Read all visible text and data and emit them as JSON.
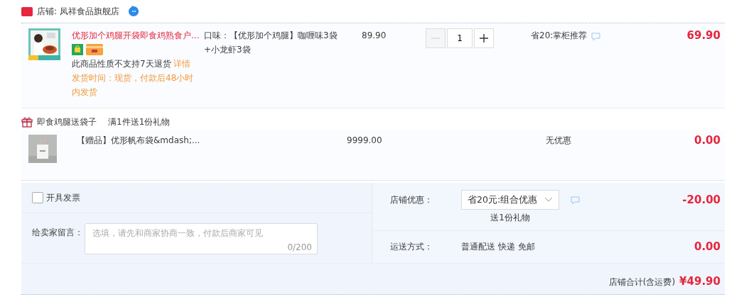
{
  "shop": {
    "label": "店铺: 凤祥食品旗舰店"
  },
  "items": [
    {
      "title": "优形加个鸡腿开袋即食鸡熟食户...",
      "spec": "口味：【优形加个鸡腿】咖喱味3袋+小龙虾3袋",
      "price": "89.90",
      "quantity": "1",
      "promo": "省20:掌柜推荐",
      "notice": "此商品性质不支持7天退货",
      "notice_link": "详情",
      "delivery": "发货时间：现货，付款后48小时内发货",
      "total": "69.90"
    }
  ],
  "gift_group": {
    "title": "即食鸡腿送袋子",
    "rule": "满1件送1份礼物"
  },
  "gifts": [
    {
      "title": "【赠品】优形帆布袋&mdash;...",
      "price": "9999.00",
      "promo": "无优惠",
      "total": "0.00"
    }
  ],
  "invoice": {
    "label": "开具发票",
    "checked": false
  },
  "message": {
    "label": "给卖家留言：",
    "placeholder": "选填，请先和商家协商一致，付款后商家可见",
    "counter": "0/200"
  },
  "shop_discount": {
    "label": "店铺优惠：",
    "value": "省20元:组合优惠",
    "note": "送1份礼物",
    "amount": "-20.00"
  },
  "shipping": {
    "label": "运送方式：",
    "value": "普通配送 快递 免邮",
    "amount": "0.00"
  },
  "shop_total": {
    "label": "店铺合计(含运费)",
    "amount": "¥49.90"
  }
}
